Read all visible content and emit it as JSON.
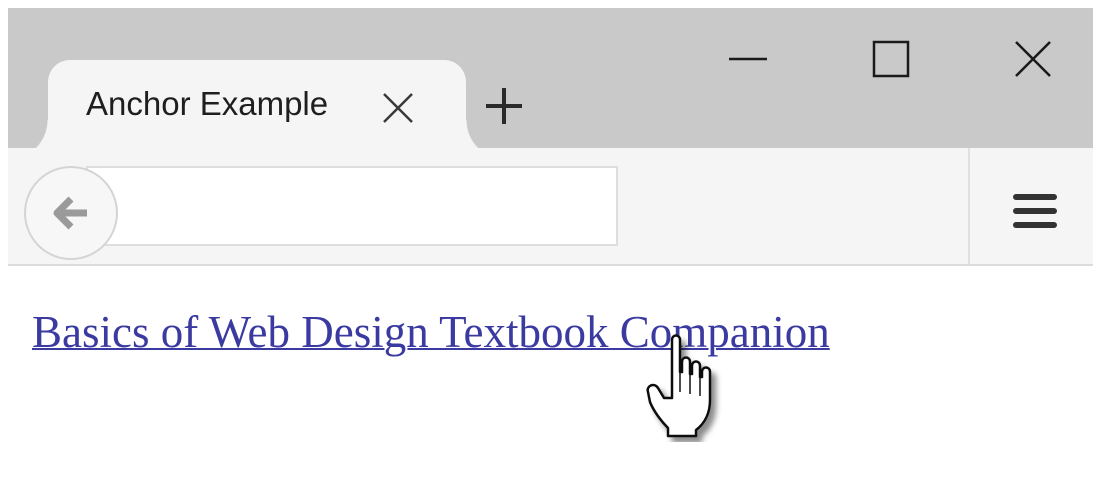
{
  "browser": {
    "tab": {
      "title": "Anchor Example",
      "close_icon": "close-icon"
    },
    "new_tab_icon": "plus-icon",
    "window_controls": [
      "minimize-icon",
      "maximize-icon",
      "close-icon"
    ],
    "nav": {
      "back_icon": "back-arrow-icon",
      "url": "",
      "menu_icon": "hamburger-menu-icon"
    }
  },
  "page": {
    "link_text": "Basics of Web Design Textbook Companion",
    "link_color": "#3a3aa0",
    "cursor": "hand-pointer-icon"
  }
}
